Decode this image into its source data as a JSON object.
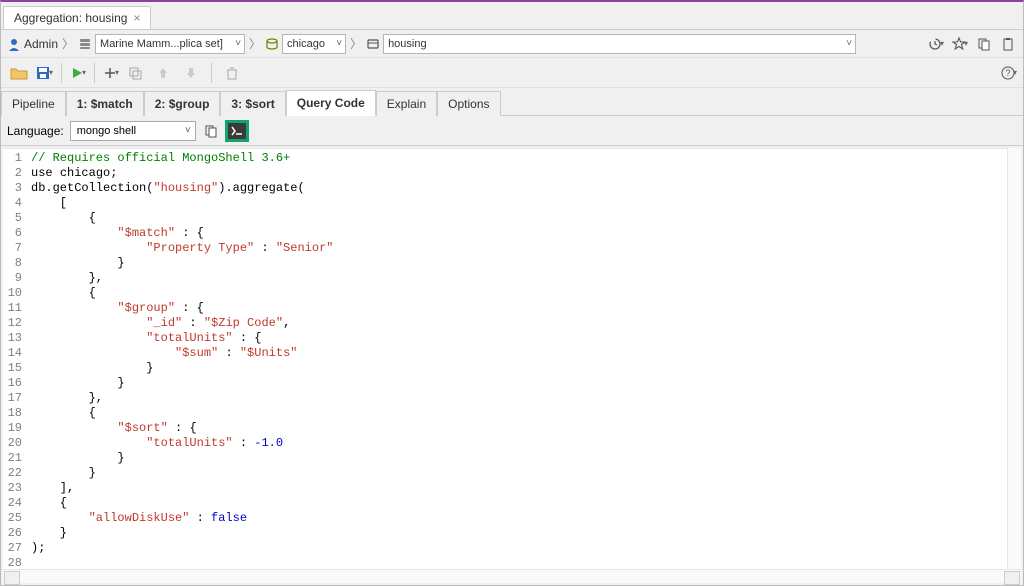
{
  "docTab": {
    "title": "Aggregation: housing"
  },
  "breadcrumb": {
    "user": "Admin",
    "connection": "Marine Mamm...plica set]",
    "database": "chicago",
    "collection": "housing"
  },
  "tabs": [
    {
      "label": "Pipeline",
      "active": false
    },
    {
      "label": "1: $match",
      "active": false
    },
    {
      "label": "2: $group",
      "active": false
    },
    {
      "label": "3: $sort",
      "active": false
    },
    {
      "label": "Query Code",
      "active": true
    },
    {
      "label": "Explain",
      "active": false
    },
    {
      "label": "Options",
      "active": false
    }
  ],
  "language": {
    "label": "Language:",
    "selected": "mongo shell"
  },
  "code": {
    "lines": [
      {
        "n": 1,
        "tokens": [
          {
            "t": "// Requires official MongoShell 3.6+",
            "c": "com"
          }
        ]
      },
      {
        "n": 2,
        "tokens": [
          {
            "t": "use ",
            "c": "id"
          },
          {
            "t": "chicago",
            "c": "id"
          },
          {
            "t": ";",
            "c": "id"
          }
        ]
      },
      {
        "n": 3,
        "tokens": [
          {
            "t": "db",
            "c": "id"
          },
          {
            "t": ".",
            "c": "id"
          },
          {
            "t": "getCollection",
            "c": "id"
          },
          {
            "t": "(",
            "c": "id"
          },
          {
            "t": "\"housing\"",
            "c": "str"
          },
          {
            "t": ")",
            "c": "id"
          },
          {
            "t": ".",
            "c": "id"
          },
          {
            "t": "aggregate",
            "c": "id"
          },
          {
            "t": "(",
            "c": "id"
          }
        ]
      },
      {
        "n": 4,
        "tokens": [
          {
            "t": "    [",
            "c": "id"
          }
        ]
      },
      {
        "n": 5,
        "tokens": [
          {
            "t": "        {",
            "c": "id"
          }
        ]
      },
      {
        "n": 6,
        "tokens": [
          {
            "t": "            ",
            "c": "id"
          },
          {
            "t": "\"$match\"",
            "c": "str"
          },
          {
            "t": " : {",
            "c": "id"
          }
        ]
      },
      {
        "n": 7,
        "tokens": [
          {
            "t": "                ",
            "c": "id"
          },
          {
            "t": "\"Property Type\"",
            "c": "str"
          },
          {
            "t": " : ",
            "c": "id"
          },
          {
            "t": "\"Senior\"",
            "c": "str"
          }
        ]
      },
      {
        "n": 8,
        "tokens": [
          {
            "t": "            }",
            "c": "id"
          }
        ]
      },
      {
        "n": 9,
        "tokens": [
          {
            "t": "        },",
            "c": "id"
          }
        ]
      },
      {
        "n": 10,
        "tokens": [
          {
            "t": "        {",
            "c": "id"
          }
        ]
      },
      {
        "n": 11,
        "tokens": [
          {
            "t": "            ",
            "c": "id"
          },
          {
            "t": "\"$group\"",
            "c": "str"
          },
          {
            "t": " : {",
            "c": "id"
          }
        ]
      },
      {
        "n": 12,
        "tokens": [
          {
            "t": "                ",
            "c": "id"
          },
          {
            "t": "\"_id\"",
            "c": "str"
          },
          {
            "t": " : ",
            "c": "id"
          },
          {
            "t": "\"$Zip Code\"",
            "c": "str"
          },
          {
            "t": ",",
            "c": "id"
          }
        ]
      },
      {
        "n": 13,
        "tokens": [
          {
            "t": "                ",
            "c": "id"
          },
          {
            "t": "\"totalUnits\"",
            "c": "str"
          },
          {
            "t": " : {",
            "c": "id"
          }
        ]
      },
      {
        "n": 14,
        "tokens": [
          {
            "t": "                    ",
            "c": "id"
          },
          {
            "t": "\"$sum\"",
            "c": "str"
          },
          {
            "t": " : ",
            "c": "id"
          },
          {
            "t": "\"$Units\"",
            "c": "str"
          }
        ]
      },
      {
        "n": 15,
        "tokens": [
          {
            "t": "                }",
            "c": "id"
          }
        ]
      },
      {
        "n": 16,
        "tokens": [
          {
            "t": "            }",
            "c": "id"
          }
        ]
      },
      {
        "n": 17,
        "tokens": [
          {
            "t": "        },",
            "c": "id"
          }
        ]
      },
      {
        "n": 18,
        "tokens": [
          {
            "t": "        {",
            "c": "id"
          }
        ]
      },
      {
        "n": 19,
        "tokens": [
          {
            "t": "            ",
            "c": "id"
          },
          {
            "t": "\"$sort\"",
            "c": "str"
          },
          {
            "t": " : {",
            "c": "id"
          }
        ]
      },
      {
        "n": 20,
        "tokens": [
          {
            "t": "                ",
            "c": "id"
          },
          {
            "t": "\"totalUnits\"",
            "c": "str"
          },
          {
            "t": " : ",
            "c": "id"
          },
          {
            "t": "-1.0",
            "c": "kw"
          }
        ]
      },
      {
        "n": 21,
        "tokens": [
          {
            "t": "            }",
            "c": "id"
          }
        ]
      },
      {
        "n": 22,
        "tokens": [
          {
            "t": "        }",
            "c": "id"
          }
        ]
      },
      {
        "n": 23,
        "tokens": [
          {
            "t": "    ],",
            "c": "id"
          }
        ]
      },
      {
        "n": 24,
        "tokens": [
          {
            "t": "    {",
            "c": "id"
          }
        ]
      },
      {
        "n": 25,
        "tokens": [
          {
            "t": "        ",
            "c": "id"
          },
          {
            "t": "\"allowDiskUse\"",
            "c": "str"
          },
          {
            "t": " : ",
            "c": "id"
          },
          {
            "t": "false",
            "c": "kw"
          }
        ]
      },
      {
        "n": 26,
        "tokens": [
          {
            "t": "    }",
            "c": "id"
          }
        ]
      },
      {
        "n": 27,
        "tokens": [
          {
            "t": ");",
            "c": "id"
          }
        ]
      },
      {
        "n": 28,
        "tokens": []
      }
    ]
  }
}
